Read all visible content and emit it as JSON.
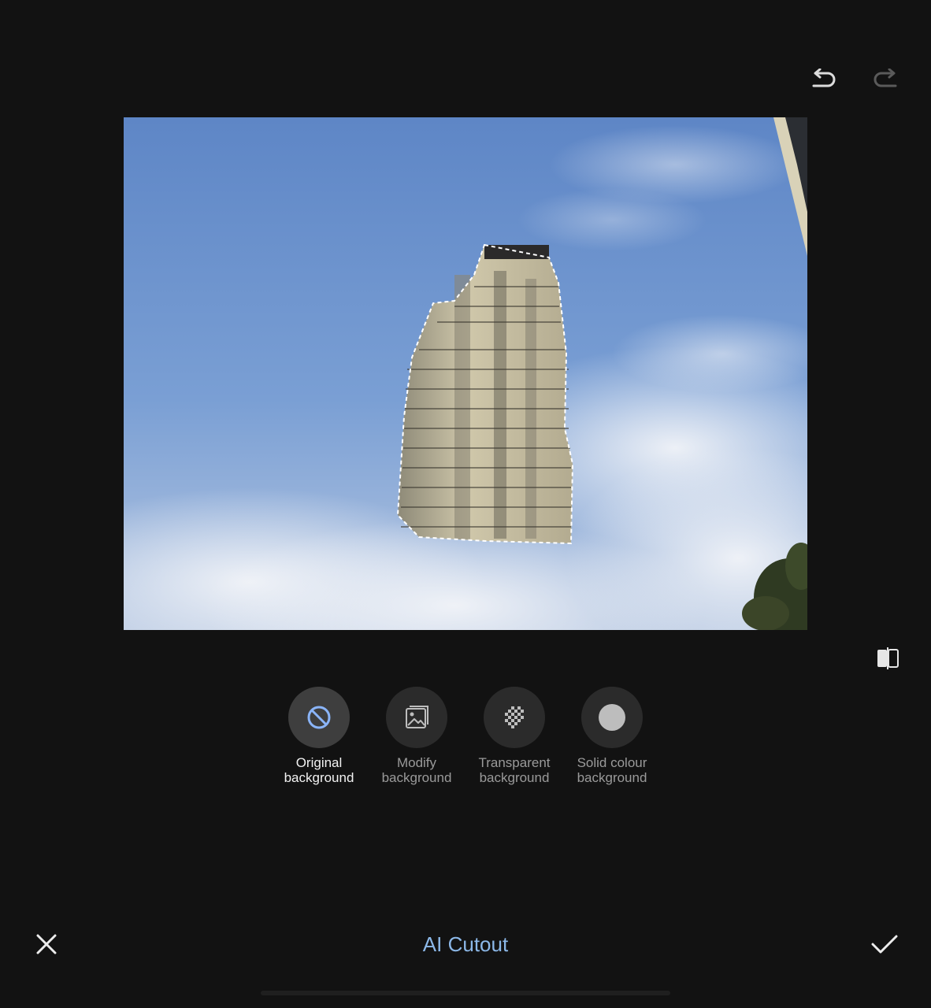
{
  "toolbar": {
    "undo_icon": "undo-icon",
    "redo_icon": "redo-icon",
    "compare_icon": "compare-split-icon"
  },
  "background_options": [
    {
      "label": "Original\nbackground",
      "icon": "no-background-icon",
      "selected": true
    },
    {
      "label": "Modify\nbackground",
      "icon": "image-icon",
      "selected": false
    },
    {
      "label": "Transparent\nbackground",
      "icon": "checkerboard-icon",
      "selected": false
    },
    {
      "label": "Solid colour\nbackground",
      "icon": "solid-circle-icon",
      "selected": false
    }
  ],
  "bottom_bar": {
    "title": "AI Cutout",
    "close_icon": "close-icon",
    "confirm_icon": "check-icon"
  },
  "colors": {
    "background": "#121212",
    "accent": "#8cb8e8",
    "selected_icon": "#8ab4f8"
  }
}
